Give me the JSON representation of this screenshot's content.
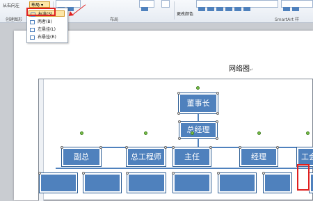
{
  "ribbon": {
    "from_right_left_label": "从右向左",
    "layout_button_label": "布局",
    "group_create_graphic": "创建图形",
    "group_layout": "布局",
    "change_colors_label": "更改颜色",
    "group_smartart_styles": "SmartArt 样"
  },
  "layout_menu": {
    "items": [
      {
        "label": "标准(S)",
        "selected": true
      },
      {
        "label": "两者(B)",
        "selected": false
      },
      {
        "label": "左悬挂(L)",
        "selected": false
      },
      {
        "label": "右悬挂(R)",
        "selected": false
      }
    ]
  },
  "document": {
    "title": "网络图",
    "paragraph_mark": "↵"
  },
  "org_chart": {
    "top": "董事长",
    "second": "总经理",
    "third_row": [
      "副总",
      "总工程师",
      "主任",
      "经理",
      "工会"
    ]
  },
  "colors": {
    "shape_fill": "#4f81bd",
    "highlight": "#e02020",
    "selected_menu_fill": "#fde6a6"
  }
}
